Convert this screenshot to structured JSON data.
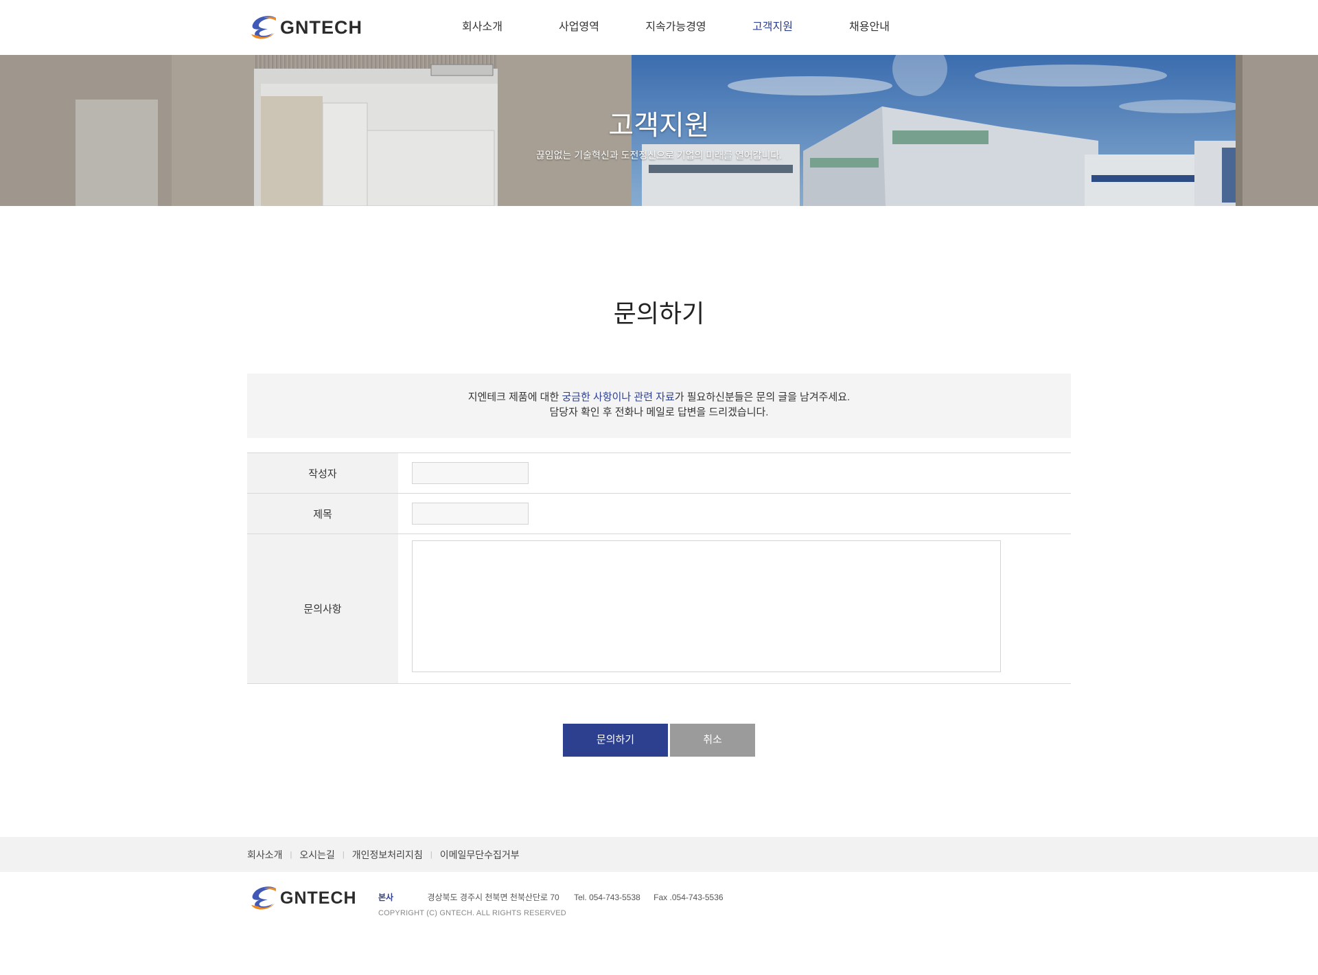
{
  "brand": {
    "name": "GNTECH",
    "colors": {
      "primary": "#2d3f8f",
      "logo_blue": "#3f59b5",
      "logo_orange": "#f08a1e",
      "cancel": "#9b9b9b"
    }
  },
  "nav": {
    "items": [
      {
        "label": "회사소개"
      },
      {
        "label": "사업영역"
      },
      {
        "label": "지속가능경영"
      },
      {
        "label": "고객지원",
        "active": true
      },
      {
        "label": "채용안내"
      }
    ]
  },
  "banner": {
    "title": "고객지원",
    "subtitle": "끊임없는 기술혁신과 도전정신으로 기업의 미래를 열어갑니다."
  },
  "main": {
    "title": "문의하기",
    "notice": {
      "line1_pre": "지엔테크 제품에 대한 ",
      "line1_hl": "궁금한 사항이나 관련 자료",
      "line1_post": "가 필요하신분들은 문의 글을 남겨주세요.",
      "line2": "담당자 확인 후 전화나 메일로 답변을 드리겠습니다."
    },
    "form": {
      "writer_label": "작성자",
      "writer_value": "",
      "subject_label": "제목",
      "subject_value": "",
      "content_label": "문의사항",
      "content_value": ""
    },
    "buttons": {
      "submit": "문의하기",
      "cancel": "취소"
    }
  },
  "footer": {
    "links": [
      "회사소개",
      "오시는길",
      "개인정보처리지침",
      "이메일무단수집거부"
    ],
    "separator": "|",
    "hq_label": "본사",
    "address": "경상북도 경주시 천북면 천북산단로 70",
    "tel": "Tel. 054-743-5538",
    "fax": "Fax .054-743-5536",
    "copyright": "COPYRIGHT (C) GNTECH. ALL RIGHTS RESERVED"
  }
}
